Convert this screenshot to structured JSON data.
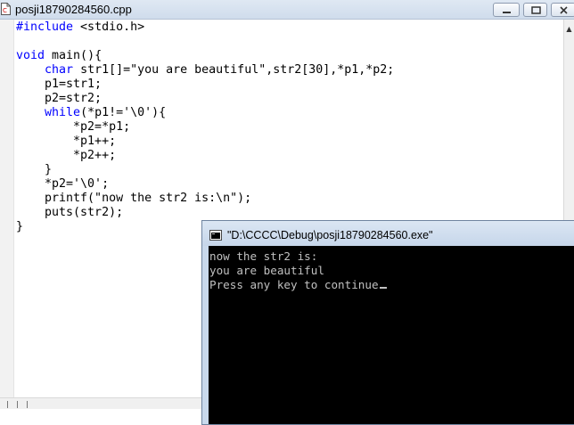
{
  "editor": {
    "title": "posji18790284560.cpp",
    "code_lines": [
      [
        {
          "t": "#include",
          "c": "pp"
        },
        {
          "t": " <stdio.h>",
          "c": ""
        }
      ],
      [],
      [
        {
          "t": "void",
          "c": "kw"
        },
        {
          "t": " main(){",
          "c": ""
        }
      ],
      [
        {
          "t": "    ",
          "c": ""
        },
        {
          "t": "char",
          "c": "kw"
        },
        {
          "t": " str1[]=\"you are beautiful\",str2[30],*p1,*p2;",
          "c": ""
        }
      ],
      [
        {
          "t": "    p1=str1;",
          "c": ""
        }
      ],
      [
        {
          "t": "    p2=str2;",
          "c": ""
        }
      ],
      [
        {
          "t": "    ",
          "c": ""
        },
        {
          "t": "while",
          "c": "kw"
        },
        {
          "t": "(*p1!='\\0'){",
          "c": ""
        }
      ],
      [
        {
          "t": "        *p2=*p1;",
          "c": ""
        }
      ],
      [
        {
          "t": "        *p1++;",
          "c": ""
        }
      ],
      [
        {
          "t": "        *p2++;",
          "c": ""
        }
      ],
      [
        {
          "t": "    }",
          "c": ""
        }
      ],
      [
        {
          "t": "    *p2='\\0';",
          "c": ""
        }
      ],
      [
        {
          "t": "    printf(\"now the str2 is:\\n\");",
          "c": ""
        }
      ],
      [
        {
          "t": "    puts(str2);",
          "c": ""
        }
      ],
      [
        {
          "t": "}",
          "c": ""
        }
      ]
    ]
  },
  "window_buttons": {
    "minimize": "minimize-icon",
    "maximize": "maximize-icon",
    "close": "close-icon"
  },
  "console": {
    "title": "\"D:\\CCCC\\Debug\\posji18790284560.exe\"",
    "lines": [
      "now the str2 is:",
      "you are beautiful",
      "Press any key to continue"
    ]
  },
  "colors": {
    "keyword": "#0000ff",
    "console_bg": "#000000",
    "console_text": "#c0c0c0"
  }
}
